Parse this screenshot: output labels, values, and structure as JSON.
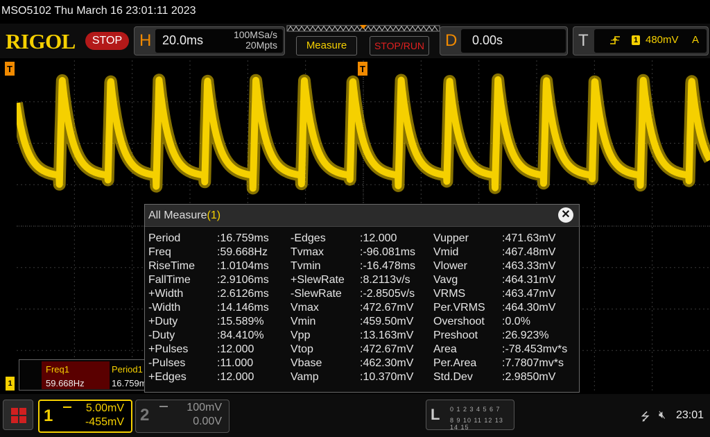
{
  "title_line": "MSO5102  Thu March 16 23:01:11 2023",
  "header": {
    "logo": "RIGOL",
    "run_state": "STOP",
    "horizontal": {
      "letter": "H",
      "timebase": "20.0ms",
      "sample_rate": "100MSa/s",
      "memory_depth": "20Mpts"
    },
    "measure_button": "Measure",
    "stoprun_button": "STOP/RUN",
    "delay": {
      "letter": "D",
      "value": "0.00s"
    },
    "trigger": {
      "letter": "T",
      "source": "1",
      "level": "480mV",
      "mode": "A",
      "edge_icon": "rising-edge-icon"
    }
  },
  "markers": {
    "left": "T",
    "top": "T",
    "channel": "1"
  },
  "colors": {
    "ch1": "#f5d000",
    "accent": "#f18a00",
    "stop": "#b31919"
  },
  "waveform": {
    "period_ms": 16.759,
    "rise_ms": 1.0104,
    "fall_ms": 2.9106,
    "vmax_mV": 472.67,
    "vmin_mV": 459.5
  },
  "measure_window": {
    "title": "All Measure",
    "count": "(1)",
    "close_icon": "close-icon",
    "rows": [
      [
        "Period",
        ":16.759ms",
        "-Edges",
        ":12.000",
        "Vupper",
        ":471.63mV"
      ],
      [
        "Freq",
        ":59.668Hz",
        "Tvmax",
        ":-96.081ms",
        "Vmid",
        ":467.48mV"
      ],
      [
        "RiseTime",
        ":1.0104ms",
        "Tvmin",
        ":-16.478ms",
        "Vlower",
        ":463.33mV"
      ],
      [
        "FallTime",
        ":2.9106ms",
        "+SlewRate",
        ":8.2113v/s",
        "Vavg",
        ":464.31mV"
      ],
      [
        "+Width",
        ":2.6126ms",
        "-SlewRate",
        ":-2.8505v/s",
        "VRMS",
        ":463.47mV"
      ],
      [
        "-Width",
        ":14.146ms",
        "Vmax",
        ":472.67mV",
        "Per.VRMS",
        ":464.30mV"
      ],
      [
        "+Duty",
        ":15.589%",
        "Vmin",
        ":459.50mV",
        "Overshoot",
        ":0.0%"
      ],
      [
        "-Duty",
        ":84.410%",
        "Vpp",
        ":13.163mV",
        "Preshoot",
        ":26.923%"
      ],
      [
        "+Pulses",
        ":12.000",
        "Vtop",
        ":472.67mV",
        "Area",
        ":-78.453mv*s"
      ],
      [
        "-Pulses",
        ":11.000",
        "Vbase",
        ":462.30mV",
        "Per.Area",
        ":7.7807mv*s"
      ],
      [
        "+Edges",
        ":12.000",
        "Vamp",
        ":10.370mV",
        "Std.Dev",
        ":2.9850mV"
      ]
    ]
  },
  "stat_panel": {
    "col1_label": "Freq1",
    "col1_value": "59.668Hz",
    "col2_label": "Period1",
    "col2_value": "16.759m"
  },
  "bottom": {
    "menu_icon": "menu-grid-icon",
    "ch1": {
      "num": "1",
      "scale": "5.00mV",
      "offset": "-455mV"
    },
    "ch2": {
      "num": "2",
      "scale": "100mV",
      "offset": "0.00V"
    },
    "la": {
      "letter": "L",
      "row1": "0 1 2 3   4 5 6 7",
      "row2": "8 9 10 11  12 13 14 15"
    },
    "usb_icon": "usb-icon",
    "speaker_icon": "speaker-muted-icon",
    "time": "23:01"
  }
}
